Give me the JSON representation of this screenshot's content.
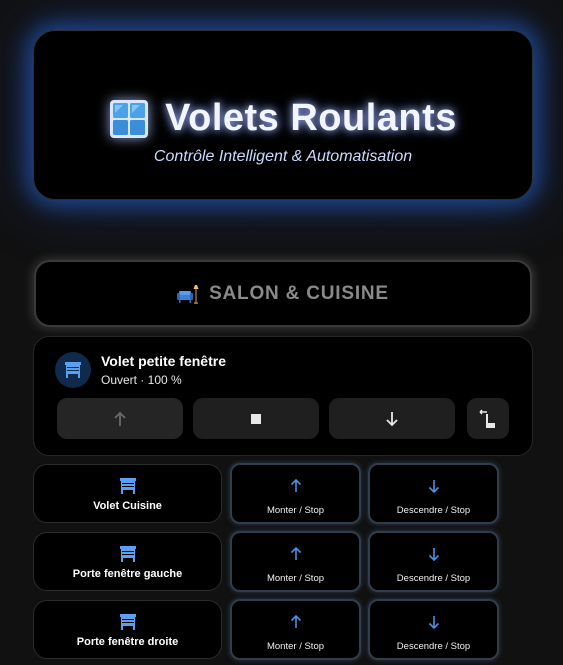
{
  "header": {
    "title": "Volets Roulants",
    "subtitle": "Contrôle Intelligent & Automatisation",
    "icon": "window-icon"
  },
  "section": {
    "title": "SALON & CUISINE",
    "icon": "sofa-lamp-icon"
  },
  "main_cover": {
    "name": "Volet petite fenêtre",
    "status": "Ouvert · 100 %",
    "icon": "shutter-icon",
    "buttons": [
      "arrow-up-icon",
      "stop-icon",
      "arrow-down-icon",
      "swap-gesture-icon"
    ]
  },
  "covers": [
    {
      "name": "Volet Cuisine",
      "up_label": "Monter / Stop",
      "down_label": "Descendre / Stop"
    },
    {
      "name": "Porte fenêtre gauche",
      "up_label": "Monter / Stop",
      "down_label": "Descendre / Stop"
    },
    {
      "name": "Porte fenêtre droite",
      "up_label": "Monter / Stop",
      "down_label": "Descendre / Stop"
    }
  ],
  "colors": {
    "accent": "#4a8fe7",
    "glow": "#2c6ee6",
    "background": "#111111",
    "card": "#000000"
  }
}
